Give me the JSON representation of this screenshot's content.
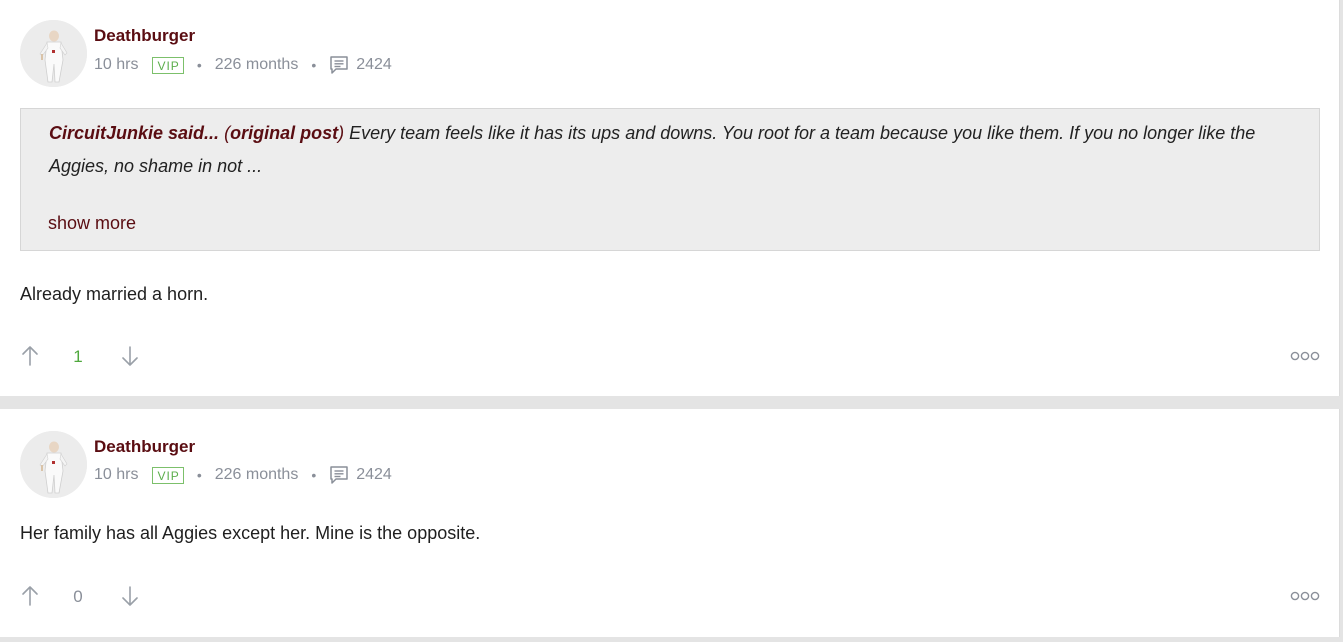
{
  "colors": {
    "username": "#5a0d12",
    "meta": "#8a8f99",
    "vip_badge": "#5cae4c",
    "vote_positive": "#4fa83d",
    "quote_bg": "#ededed"
  },
  "posts": [
    {
      "username": "Deathburger",
      "time_ago": "10 hrs",
      "badge": "VIP",
      "member_duration": "226 months",
      "comment_icon": "comment-icon",
      "post_count": "2424",
      "quote": {
        "author": "CircuitJunkie said...",
        "source_open": "(",
        "source": "original post",
        "source_close": ")",
        "text": " Every team feels like it has its ups and downs. You root for a team because you like them. If you no longer like the Aggies, no shame in not ...",
        "show_more_label": "show more"
      },
      "body": "Already married a horn.",
      "vote_count": "1",
      "upvote_icon": "arrow-up-icon",
      "downvote_icon": "arrow-down-icon",
      "menu_icon": "more-options-icon"
    },
    {
      "username": "Deathburger",
      "time_ago": "10 hrs",
      "badge": "VIP",
      "member_duration": "226 months",
      "comment_icon": "comment-icon",
      "post_count": "2424",
      "body": "Her family has all Aggies except her. Mine is the opposite.",
      "vote_count": "0",
      "upvote_icon": "arrow-up-icon",
      "downvote_icon": "arrow-down-icon",
      "menu_icon": "more-options-icon"
    }
  ]
}
